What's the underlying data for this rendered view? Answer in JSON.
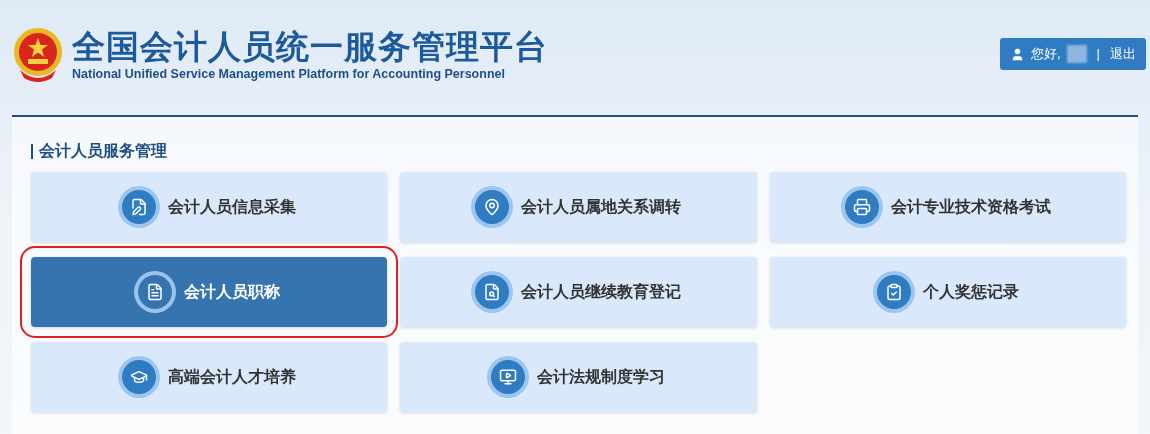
{
  "header": {
    "title": "全国会计人员统一服务管理平台",
    "subtitle": "National Unified Service Management Platform for Accounting Personnel"
  },
  "user_menu": {
    "greeting": "您好,",
    "separator": "|",
    "logout": "退出"
  },
  "section": {
    "title": "会计人员服务管理"
  },
  "tiles": [
    {
      "label": "会计人员信息采集",
      "kind": "collect",
      "selected": false
    },
    {
      "label": "会计人员属地关系调转",
      "kind": "transfer",
      "selected": false
    },
    {
      "label": "会计专业技术资格考试",
      "kind": "exam",
      "selected": false
    },
    {
      "label": "会计人员职称",
      "kind": "title",
      "selected": true
    },
    {
      "label": "会计人员继续教育登记",
      "kind": "education",
      "selected": false
    },
    {
      "label": "个人奖惩记录",
      "kind": "award",
      "selected": false
    },
    {
      "label": "高端会计人才培养",
      "kind": "training",
      "selected": false
    },
    {
      "label": "会计法规制度学习",
      "kind": "law",
      "selected": false
    }
  ]
}
